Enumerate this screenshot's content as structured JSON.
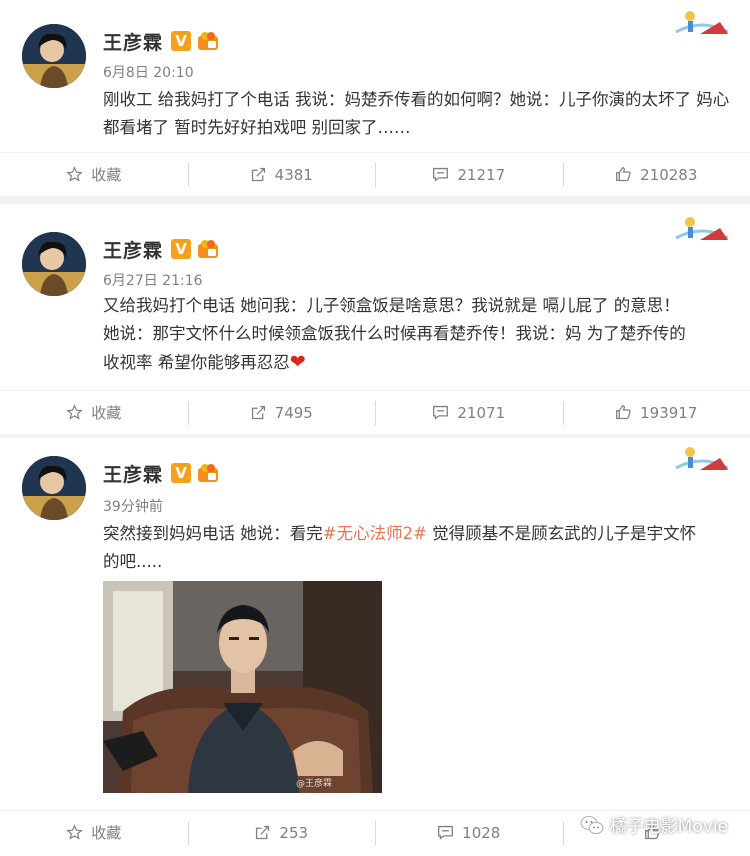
{
  "posts": [
    {
      "username": "王彦霖",
      "v_badge": "V",
      "time": "6月8日 20:10",
      "text": "刚收工 给我妈打了个电话 我说：妈楚乔传看的如何啊？她说：儿子你演的太坏了 妈心都看堵了 暂时先好好拍戏吧 别回家了……",
      "actions": {
        "favorite": "收藏",
        "repost": "4381",
        "comment": "21217",
        "like": "210283"
      }
    },
    {
      "username": "王彦霖",
      "v_badge": "V",
      "time": "6月27日 21:16",
      "text_line1": "又给我妈打个电话 她问我：儿子领盒饭是啥意思？我说就是 嗝儿屁了 的意思！",
      "text_line2": "她说：那宇文怀什么时候领盒饭我什么时候再看楚乔传！我说：妈 为了楚乔传的",
      "text_line3": "收视率 希望你能够再忍忍",
      "heart": "❤",
      "actions": {
        "favorite": "收藏",
        "repost": "7495",
        "comment": "21071",
        "like": "193917"
      }
    },
    {
      "username": "王彦霖",
      "v_badge": "V",
      "time": "39分钟前",
      "text_before": "突然接到妈妈电话 她说：看完",
      "topic": "#无心法师2#",
      "text_after": " 觉得顾基不是顾玄武的儿子是宇文怀",
      "text_line2": "的吧.....",
      "photo_watermark": "@王彦霖",
      "actions": {
        "favorite": "收藏",
        "repost": "253",
        "comment": "1028"
      }
    }
  ],
  "watermark": "橘子电影Movie",
  "colors": {
    "topic": "#eb7350",
    "vip": "#f7a11a",
    "meta": "#808080"
  },
  "icons": [
    "star-icon",
    "repost-icon",
    "comment-icon",
    "thumbs-up-icon",
    "wechat-icon"
  ]
}
